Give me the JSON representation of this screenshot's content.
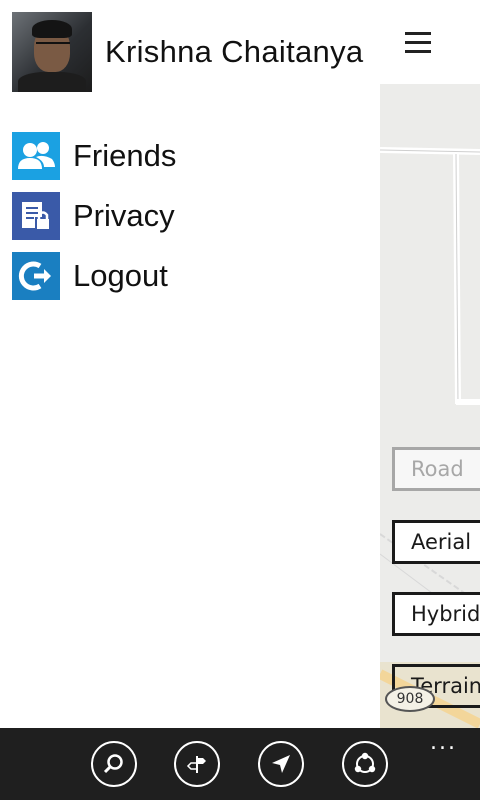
{
  "profile": {
    "name": "Krishna Chaitanya",
    "avatar_icon": "user-photo"
  },
  "header": {
    "menu_icon": "hamburger-icon"
  },
  "menu": {
    "items": [
      {
        "label": "Friends",
        "icon": "friends-icon",
        "color": "#1ba1e2"
      },
      {
        "label": "Privacy",
        "icon": "privacy-lock-icon",
        "color": "#3a5aa8"
      },
      {
        "label": "Logout",
        "icon": "logout-icon",
        "color": "#1a7fc1"
      }
    ]
  },
  "map": {
    "styles": [
      "Road",
      "Aerial",
      "Hybrid",
      "Terrain"
    ],
    "selected": "Road",
    "road_marker": "908"
  },
  "appbar": {
    "buttons": [
      "search-icon",
      "directions-icon",
      "locate-icon",
      "share-icon"
    ],
    "more": "..."
  },
  "colors": {
    "appbar_bg": "#1f1f1f",
    "map_bg": "#ececea"
  }
}
